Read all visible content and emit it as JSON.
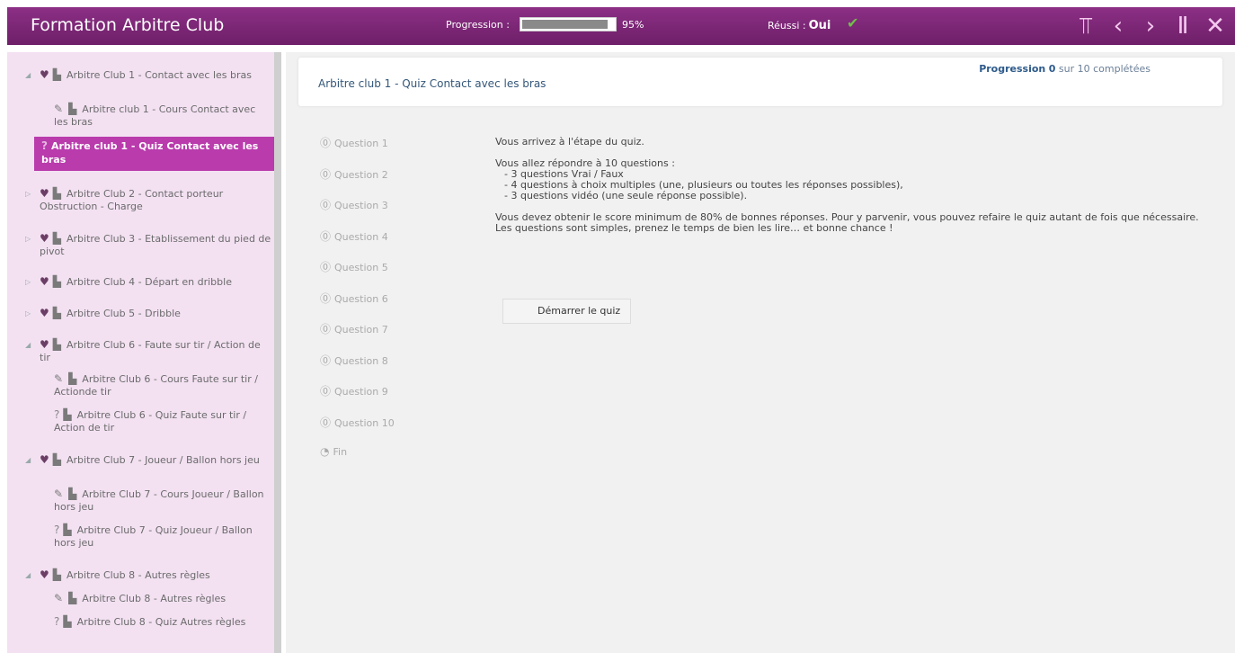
{
  "app_title": "Formation Arbitre Club",
  "progress": {
    "label": "Progression :",
    "value_text": "95%",
    "fraction": 0.95
  },
  "success": {
    "label": "Réussi :",
    "value": "Oui"
  },
  "nav_icons": [
    "sitemap-icon",
    "previous-icon",
    "next-icon",
    "pause-icon",
    "close-icon"
  ],
  "sidebar": {
    "items": [
      {
        "label": "Arbitre Club 1 - Contact avec les bras",
        "icon": "pin"
      },
      {
        "label": "Arbitre club 1 - Cours Contact avec les bras",
        "icon": "doc"
      },
      {
        "label": "Arbitre club 1 - Quiz Contact avec les bras",
        "icon": "quiz"
      },
      {
        "label": "Arbitre Club 2 - Contact porteur Obstruction - Charge",
        "icon": "pin"
      },
      {
        "label": "Arbitre Club 3 - Etablissement du pied de pivot",
        "icon": "pin"
      },
      {
        "label": "Arbitre Club 4 - Départ en dribble",
        "icon": "pin"
      },
      {
        "label": "Arbitre Club 5 - Dribble",
        "icon": "pin"
      },
      {
        "label": "Arbitre Club 6 - Faute sur tir / Action de tir",
        "icon": "pin"
      },
      {
        "label": "Arbitre Club 6 - Cours Faute sur tir / Actionde tir",
        "icon": "doc"
      },
      {
        "label": "Arbitre Club 6 - Quiz Faute sur tir / Action de tir",
        "icon": "quiz"
      },
      {
        "label": "Arbitre Club 7 - Joueur / Ballon hors jeu",
        "icon": "pin"
      },
      {
        "label": "Arbitre Club 7 - Cours Joueur / Ballon hors jeu",
        "icon": "doc"
      },
      {
        "label": "Arbitre Club 7 - Quiz Joueur / Ballon hors jeu",
        "icon": "quiz"
      },
      {
        "label": "Arbitre Club 8 - Autres règles",
        "icon": "pin"
      },
      {
        "label": "Arbitre Club 8 - Autres règles",
        "icon": "doc"
      },
      {
        "label": "Arbitre Club 8 - Quiz Autres règles",
        "icon": "quiz"
      }
    ]
  },
  "header": {
    "quiz_title": "Arbitre club 1 - Quiz Contact avec les bras",
    "completion_prefix": "Progression",
    "completion_count": "0",
    "completion_suffix": "sur 10 complétées"
  },
  "questions": [
    "Question 1",
    "Question 2",
    "Question 3",
    "Question 4",
    "Question 5",
    "Question 6",
    "Question 7",
    "Question 8",
    "Question 9",
    "Question 10",
    "Fin"
  ],
  "intro": {
    "line1": "Vous arrivez à l'étape du quiz.",
    "line2": "Vous allez répondre à 10 questions :",
    "bullet1": "- 3 questions Vrai / Faux",
    "bullet2": "- 4 questions à choix multiples (une, plusieurs ou toutes les réponses possibles),",
    "bullet3": "- 3 questions vidéo (une seule réponse possible).",
    "line3": "Vous devez obtenir le score minimum de 80% de bonnes réponses. Pour y parvenir, vous pouvez refaire le quiz autant de fois que nécessaire.",
    "line4": "Les questions sont simples, prenez le temps de bien les lire… et bonne chance !"
  },
  "start_button": "Démarrer le quiz",
  "colors": {
    "header": "#7a2574",
    "selected": "#b93bac",
    "sidebar": "#f3e1f2",
    "check": "#6fbf4a"
  }
}
